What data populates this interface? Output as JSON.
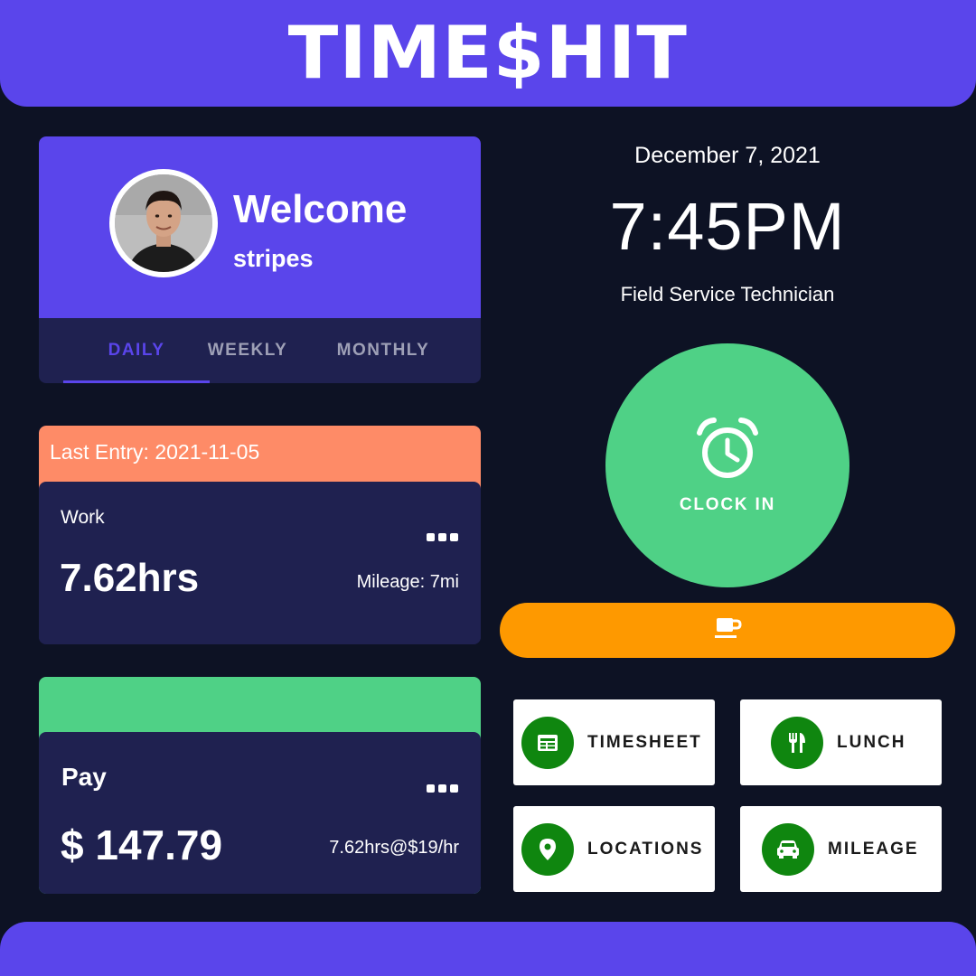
{
  "app": {
    "title": "TIME$HIT"
  },
  "welcome": {
    "greeting": "Welcome",
    "username": "stripes",
    "tabs": [
      {
        "label": "DAILY",
        "active": true
      },
      {
        "label": "WEEKLY",
        "active": false
      },
      {
        "label": "MONTHLY",
        "active": false
      }
    ]
  },
  "last_entry": {
    "banner": "Last Entry: 2021-11-05",
    "type": "Work",
    "hours": "7.62hrs",
    "mileage": "Mileage: 7mi"
  },
  "pay": {
    "title": "Pay",
    "amount": "$ 147.79",
    "rate_detail": "7.62hrs@$19/hr"
  },
  "status": {
    "date": "December 7, 2021",
    "time": "7:45PM",
    "role": "Field Service Technician"
  },
  "clock_in": {
    "label": "CLOCK IN",
    "icon": "alarm-clock-icon"
  },
  "break_button": {
    "icon": "coffee-cup-icon"
  },
  "actions": [
    {
      "label": "TIMESHEET",
      "icon": "timesheet-icon"
    },
    {
      "label": "LUNCH",
      "icon": "fork-knife-icon"
    },
    {
      "label": "LOCATIONS",
      "icon": "map-pin-icon"
    },
    {
      "label": "MILEAGE",
      "icon": "car-icon"
    }
  ],
  "colors": {
    "background": "#0d1224",
    "brand": "#5a45eb",
    "card": "#1f2150",
    "entry_banner": "#fe8b67",
    "pay_banner": "#4fd186",
    "clock_in": "#4fd186",
    "break": "#fe9900",
    "action_icon": "#0f860f"
  }
}
